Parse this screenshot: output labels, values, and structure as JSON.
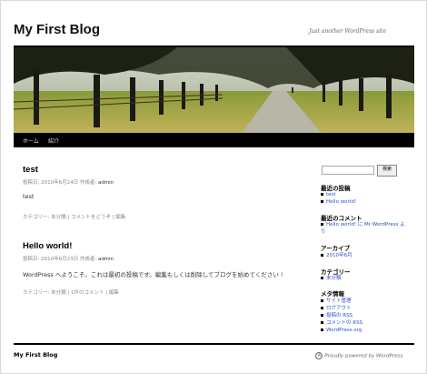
{
  "site": {
    "title": "My First Blog",
    "description": "Just another WordPress site"
  },
  "nav": {
    "items": [
      {
        "label": "ホーム"
      },
      {
        "label": "紹介"
      }
    ]
  },
  "posts": [
    {
      "title": "test",
      "meta_prefix": "投稿日: 2010年6月24日 作成者: ",
      "author": "admin",
      "content": "test",
      "utility": "カテゴリー: 未分類 | コメントをどうぞ | 編集"
    },
    {
      "title": "Hello world!",
      "meta_prefix": "投稿日: 2010年6月23日 作成者: ",
      "author": "admin",
      "content": "WordPress へようこそ。これは最初の投稿です。編集もしくは削除してブログを始めてください !",
      "utility": "カテゴリー: 未分類 | 1件のコメント | 編集"
    }
  ],
  "sidebar": {
    "search_button": "検索",
    "search_value": "",
    "widgets": [
      {
        "title": "最近の投稿",
        "items": [
          "test",
          "Hello world!"
        ]
      },
      {
        "title": "最近のコメント",
        "items": [
          "Hello world! に Mr WordPress より"
        ]
      },
      {
        "title": "アーカイブ",
        "items": [
          "2010年6月"
        ]
      },
      {
        "title": "カテゴリー",
        "items": [
          "未分類"
        ]
      },
      {
        "title": "メタ情報",
        "items": [
          "サイト管理",
          "ログアウト",
          "投稿の RSS",
          "コメントの RSS",
          "WordPress.org"
        ]
      }
    ]
  },
  "footer": {
    "name": "My First Blog",
    "credit": "Proudly powered by WordPress."
  },
  "colors": {
    "link": "#2952c9",
    "nav_bg": "#000000"
  }
}
